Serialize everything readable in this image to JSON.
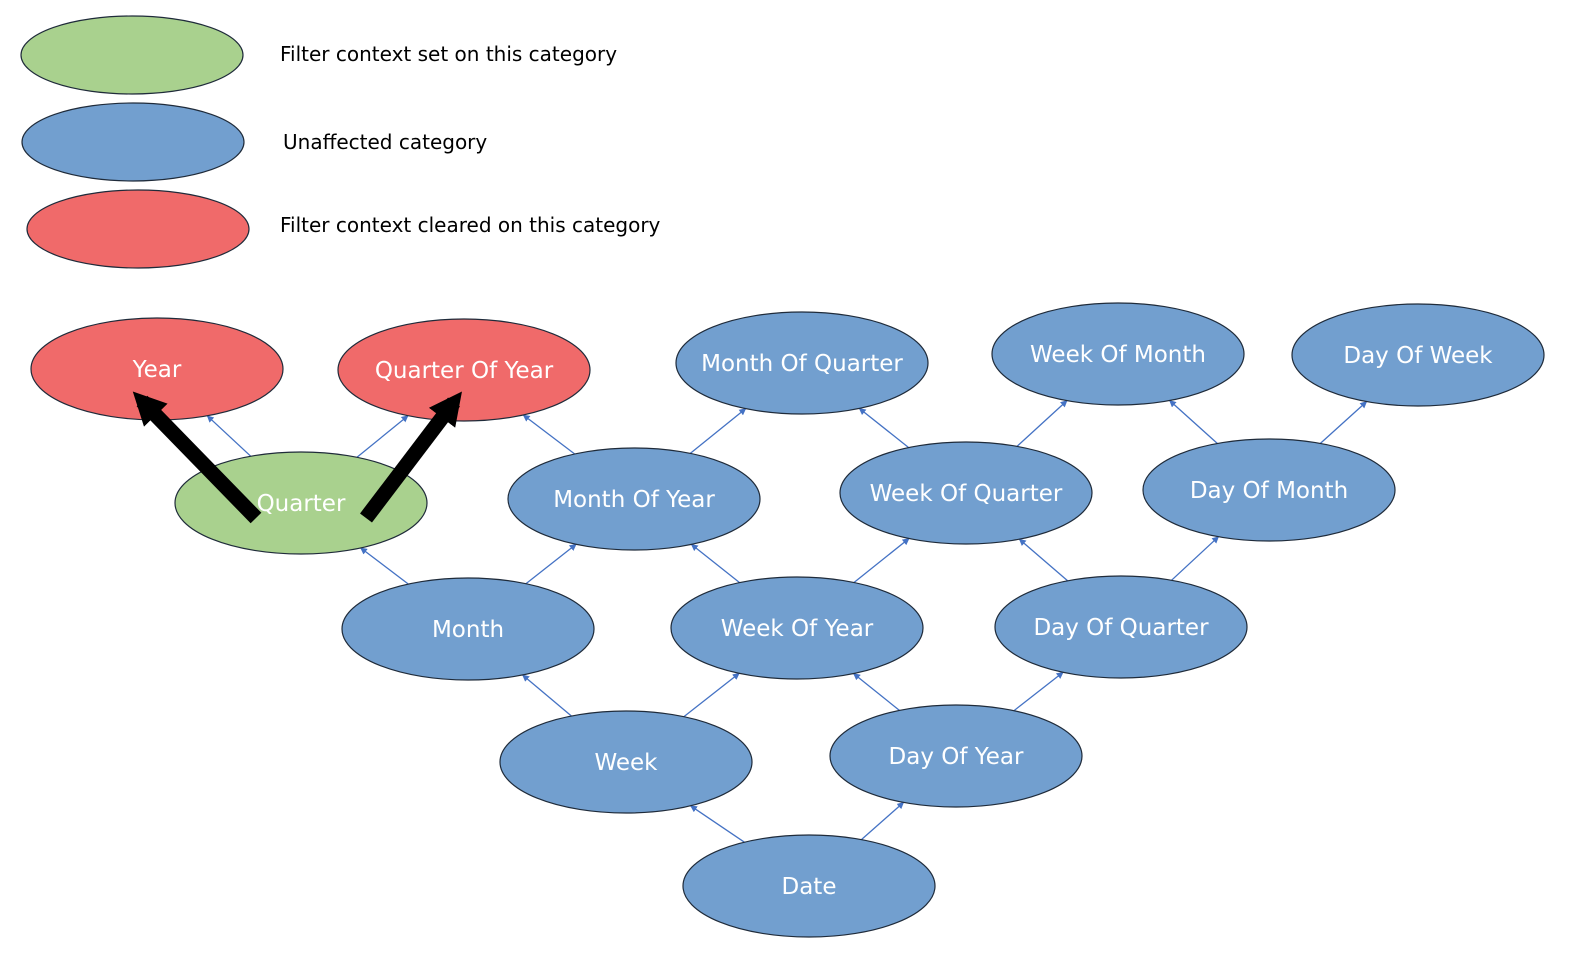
{
  "colors": {
    "set": "#a9d18e",
    "unaffected": "#729fcf",
    "cleared": "#f06a6a",
    "outline": "#1f2b3a",
    "thin_arrow": "#4472c4",
    "thick_arrow": "#000000"
  },
  "legend": [
    {
      "state": "set",
      "label": "Filter context set on this category"
    },
    {
      "state": "unaffected",
      "label": "Unaffected category"
    },
    {
      "state": "cleared",
      "label": "Filter context cleared on this category"
    }
  ],
  "nodes": {
    "year": {
      "label": "Year",
      "state": "cleared"
    },
    "quarter_of_year": {
      "label": "Quarter Of Year",
      "state": "cleared"
    },
    "month_of_quarter": {
      "label": "Month Of Quarter",
      "state": "unaffected"
    },
    "week_of_month": {
      "label": "Week Of Month",
      "state": "unaffected"
    },
    "day_of_week": {
      "label": "Day Of Week",
      "state": "unaffected"
    },
    "quarter": {
      "label": "Quarter",
      "state": "set"
    },
    "month_of_year": {
      "label": "Month Of Year",
      "state": "unaffected"
    },
    "week_of_quarter": {
      "label": "Week Of Quarter",
      "state": "unaffected"
    },
    "day_of_month": {
      "label": "Day Of Month",
      "state": "unaffected"
    },
    "month": {
      "label": "Month",
      "state": "unaffected"
    },
    "week_of_year": {
      "label": "Week Of Year",
      "state": "unaffected"
    },
    "day_of_quarter": {
      "label": "Day Of Quarter",
      "state": "unaffected"
    },
    "week": {
      "label": "Week",
      "state": "unaffected"
    },
    "day_of_year": {
      "label": "Day Of Year",
      "state": "unaffected"
    },
    "date": {
      "label": "Date",
      "state": "unaffected"
    }
  },
  "edges": [
    {
      "from": "date",
      "to": "week"
    },
    {
      "from": "date",
      "to": "day_of_year"
    },
    {
      "from": "week",
      "to": "month"
    },
    {
      "from": "week",
      "to": "week_of_year"
    },
    {
      "from": "day_of_year",
      "to": "week_of_year"
    },
    {
      "from": "day_of_year",
      "to": "day_of_quarter"
    },
    {
      "from": "month",
      "to": "quarter"
    },
    {
      "from": "month",
      "to": "month_of_year"
    },
    {
      "from": "week_of_year",
      "to": "month_of_year"
    },
    {
      "from": "week_of_year",
      "to": "week_of_quarter"
    },
    {
      "from": "day_of_quarter",
      "to": "week_of_quarter"
    },
    {
      "from": "day_of_quarter",
      "to": "day_of_month"
    },
    {
      "from": "quarter",
      "to": "year"
    },
    {
      "from": "quarter",
      "to": "quarter_of_year"
    },
    {
      "from": "month_of_year",
      "to": "quarter_of_year"
    },
    {
      "from": "month_of_year",
      "to": "month_of_quarter"
    },
    {
      "from": "week_of_quarter",
      "to": "month_of_quarter"
    },
    {
      "from": "week_of_quarter",
      "to": "week_of_month"
    },
    {
      "from": "day_of_month",
      "to": "week_of_month"
    },
    {
      "from": "day_of_month",
      "to": "day_of_week"
    }
  ],
  "filter_clear_arrows": [
    {
      "from": "quarter",
      "to": "year"
    },
    {
      "from": "quarter",
      "to": "quarter_of_year"
    }
  ]
}
